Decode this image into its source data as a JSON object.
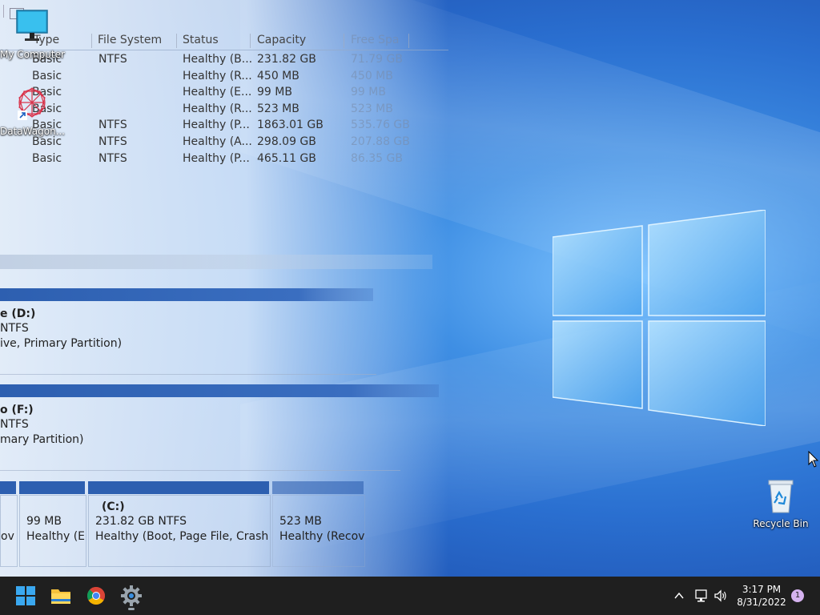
{
  "desktop": {
    "icons": [
      {
        "label": "My Computer",
        "icon": "monitor-icon"
      },
      {
        "label": "DataWagon...",
        "icon": "datawagon-icon"
      },
      {
        "label": "Recycle Bin",
        "icon": "recycle-bin-icon"
      }
    ]
  },
  "disk_management": {
    "columns": [
      "Type",
      "File System",
      "Status",
      "Capacity",
      "Free Spa"
    ],
    "rows": [
      {
        "type": "Basic",
        "fs": "NTFS",
        "status": "Healthy (B...",
        "capacity": "231.82 GB",
        "free": "71.79 GB"
      },
      {
        "type": "Basic",
        "fs": "",
        "status": "Healthy (R...",
        "capacity": "450 MB",
        "free": "450 MB"
      },
      {
        "type": "Basic",
        "fs": "",
        "status": "Healthy (E...",
        "capacity": "99 MB",
        "free": "99 MB"
      },
      {
        "type": "Basic",
        "fs": "",
        "status": "Healthy (R...",
        "capacity": "523 MB",
        "free": "523 MB"
      },
      {
        "type": "Basic",
        "fs": "NTFS",
        "status": "Healthy (P...",
        "capacity": "1863.01 GB",
        "free": "535.76 GB"
      },
      {
        "type": "Basic",
        "fs": "NTFS",
        "status": "Healthy (A...",
        "capacity": "298.09 GB",
        "free": "207.88 GB"
      },
      {
        "type": "Basic",
        "fs": "NTFS",
        "status": "Healthy (P...",
        "capacity": "465.11 GB",
        "free": "86.35 GB"
      }
    ],
    "volume_d": {
      "name": "e  (D:)",
      "fs": "NTFS",
      "desc": "ive, Primary Partition)"
    },
    "volume_f": {
      "name": "o  (F:)",
      "fs": "NTFS",
      "desc": "mary Partition)"
    },
    "disk0": {
      "part1_status": "ov",
      "part2_size": "99 MB",
      "part2_status": "Healthy (E",
      "part3_name": "(C:)",
      "part3_size": "231.82 GB NTFS",
      "part3_status": "Healthy (Boot, Page File, Crash D",
      "part4_size": "523 MB",
      "part4_status": "Healthy (Recov"
    }
  },
  "taskbar": {
    "apps": [
      "start-button",
      "file-explorer",
      "chrome",
      "settings"
    ],
    "time": "3:17 PM",
    "date": "8/31/2022",
    "notification_count": "1"
  },
  "colors": {
    "taskbar": "#1f1f1f",
    "wallpaper_blue": "#2a6fd0",
    "volume_bar": "#2d5fb0"
  }
}
